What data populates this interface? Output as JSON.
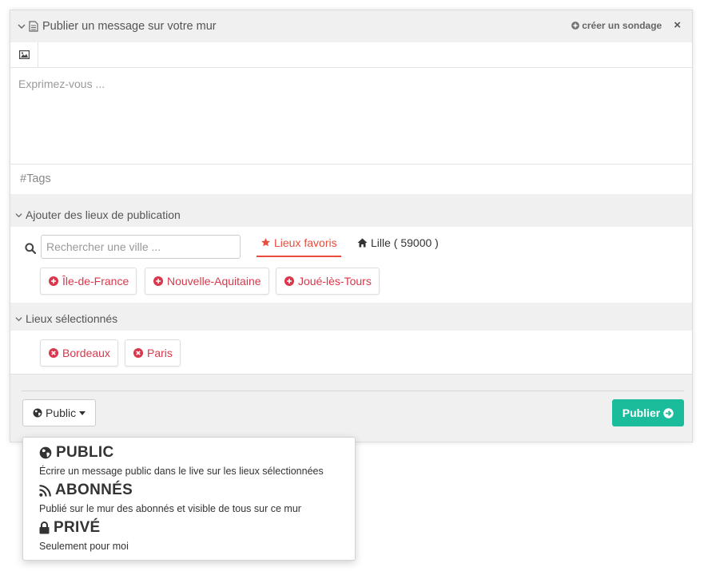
{
  "header": {
    "title": "Publier un message sur votre mur",
    "create_poll": "créer un sondage",
    "close_glyph": "×"
  },
  "editor": {
    "placeholder": "Exprimez-vous ...",
    "tags_placeholder": "#Tags"
  },
  "places": {
    "section_title": "Ajouter des lieux de publication",
    "search_placeholder": "Rechercher une ville ...",
    "tab_favorites": "Lieux favoris",
    "tab_home": "Lille ( 59000 )",
    "suggestions": [
      "Île-de-France",
      "Nouvelle-Aquitaine",
      "Joué-lès-Tours"
    ]
  },
  "selected": {
    "section_title": "Lieux sélectionnés",
    "items": [
      "Bordeaux",
      "Paris"
    ]
  },
  "footer": {
    "visibility_label": "Public",
    "publish_label": "Publier"
  },
  "visibility_menu": [
    {
      "title": "PUBLIC",
      "description": "Écrire un message public dans le live sur les lieux sélectionnées",
      "icon": "globe-icon"
    },
    {
      "title": "ABONNÉS",
      "description": "Publié sur le mur des abonnés et visible de tous sur ce mur",
      "icon": "rss-icon"
    },
    {
      "title": "PRIVÉ",
      "description": "Seulement pour moi",
      "icon": "lock-icon"
    }
  ],
  "colors": {
    "accent_red": "#e74c3c",
    "chip_text": "#d9374b",
    "publish_green": "#1abc9c",
    "panel_bg": "#f0f0f0"
  }
}
